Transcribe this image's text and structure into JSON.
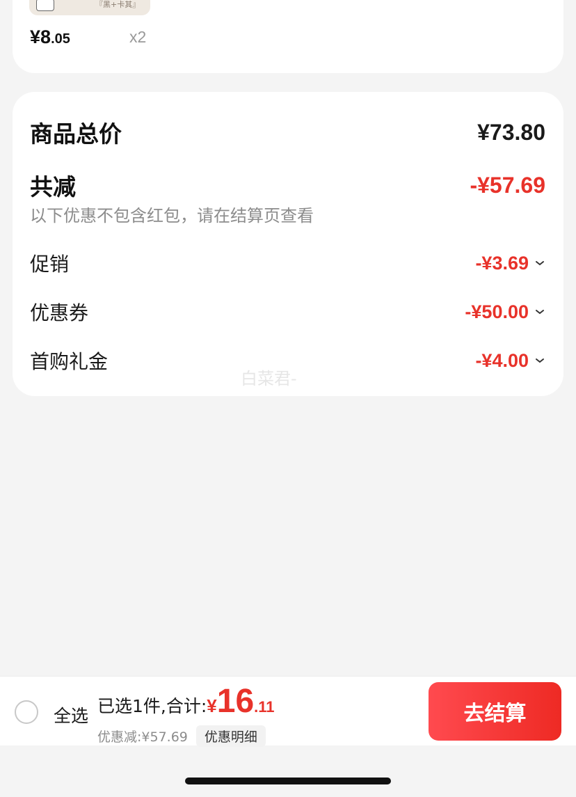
{
  "product": {
    "thumb_caption": "『黑+卡其』",
    "price_symbol": "¥",
    "price_int": "8",
    "price_dec": ".05",
    "quantity": "x2"
  },
  "summary": {
    "total_label": "商品总价",
    "total_value": "¥73.80",
    "reduction_label": "共减",
    "reduction_value": "-¥57.69",
    "note": "以下优惠不包含红包，请在结算页查看",
    "items": [
      {
        "label": "促销",
        "value": "-¥3.69"
      },
      {
        "label": "优惠券",
        "value": "-¥50.00"
      },
      {
        "label": "首购礼金",
        "value": "-¥4.00"
      }
    ],
    "watermark": "白菜君-"
  },
  "bottom": {
    "select_all": "全选",
    "selected_text": "已选1件,合计:",
    "yen": "¥",
    "total_int": "16",
    "total_dec": ".11",
    "discount_text": "优惠减:¥57.69",
    "detail_label": "优惠明细",
    "checkout_label": "去结算"
  },
  "colors": {
    "accent": "#e8322a",
    "background": "#f4f4f4"
  }
}
